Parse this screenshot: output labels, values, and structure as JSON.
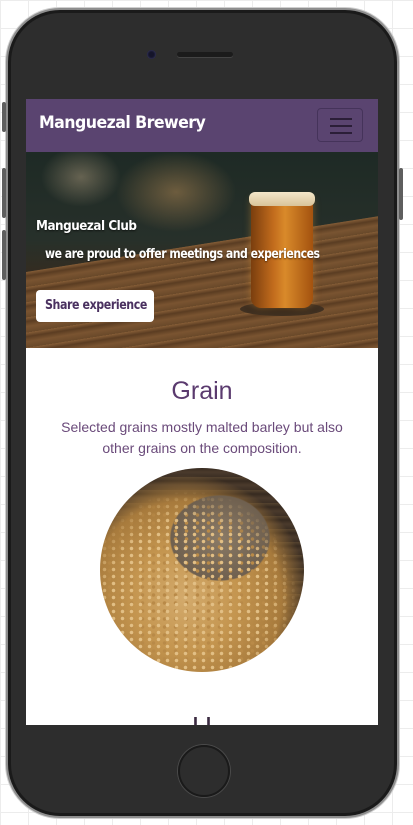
{
  "navbar": {
    "brand": "Manguezal Brewery",
    "toggler_icon": "hamburger-menu-icon"
  },
  "hero": {
    "title": "Manguezal Club",
    "subtitle": "we are proud to offer meetings and experiences",
    "button_label": "Share experience"
  },
  "section": {
    "title": "Grain",
    "text": "Selected grains mostly malted barley but also other grains on the composition."
  },
  "next_section": {
    "title_partial": "H"
  },
  "colors": {
    "navbar_bg": "#5a4470",
    "heading": "#5a3a6e",
    "body_text": "#6a4a7a"
  }
}
